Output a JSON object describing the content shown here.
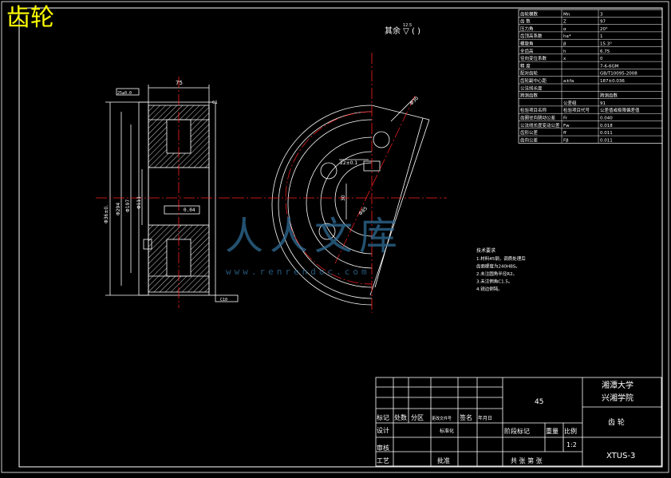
{
  "corner_title": "齿轮",
  "surface_note": "其余 ▽ ( )",
  "surface_note_small": "12.5",
  "watermark": {
    "text": "人人文库",
    "url": "www.renrendoc.com"
  },
  "dims": {
    "top_width": "75",
    "chamfer": "C1",
    "tol_box": "0.05",
    "dia_outer": "Φ36±0.",
    "dia_1": "Φ294",
    "dia_2": "Φ197",
    "dia_3": "Φ111",
    "runout": "0.04",
    "bore_small": "Φ30",
    "key_w": "22±0.1",
    "key_t": "30",
    "bore": "Φ85",
    "flatness_box": "0.0",
    "left_label": "25±0.0",
    "bottom_label": "C10"
  },
  "gear_table": [
    [
      "齿轮模数",
      "Mn",
      "3"
    ],
    [
      "齿    数",
      "Z",
      "97"
    ],
    [
      "压力角",
      "α",
      "20°"
    ],
    [
      "齿顶高系数",
      "ha*",
      "1"
    ],
    [
      "螺旋角",
      "β",
      "15.3°"
    ],
    [
      "全齿高",
      "h",
      "6.75"
    ],
    [
      "径向变位系数",
      "x",
      "0"
    ],
    [
      "精    度",
      "",
      "7-6-6GM"
    ],
    [
      "配对齿轮",
      "",
      "GB/T10095-2008"
    ],
    [
      "齿轮副中心距",
      "a±fa",
      "187±0.036"
    ],
    [
      "公法线长度",
      "",
      ""
    ],
    [
      "跨测齿数",
      "",
      "跨测齿数"
    ],
    [
      "",
      "公差组",
      "91"
    ],
    [
      "检验项目名称",
      "检验项目代号",
      "公差值或极限偏差值"
    ],
    [
      "齿圈径向跳动公差",
      "Fr",
      "0.040"
    ],
    [
      "公法线长度变动公差",
      "Fw",
      "0.018"
    ],
    [
      "齿形公差",
      "ff",
      "0.011"
    ],
    [
      "齿向公差",
      "Fβ",
      "0.011"
    ]
  ],
  "tech_req": {
    "title": "技术要求",
    "items": [
      "1.材料45钢，调质处理后",
      "齿面硬度为240HBS。",
      "2.未注圆角半径R2。",
      "3.未注倒角C1.5。",
      "4.锐边倒钝。"
    ]
  },
  "title_block": {
    "material": "45",
    "school_line1": "湘潭大学",
    "school_line2": "兴湘学院",
    "part_name": "齿    轮",
    "drawing_no": "XTUS-3",
    "scale": "1:2",
    "r1": [
      "标记",
      "处数",
      "分区",
      "更改文件号",
      "签名",
      "年月日"
    ],
    "design": "设计",
    "standard": "标准化",
    "stage_mark": "阶段标记",
    "weight": "重量",
    "ratio": "比例",
    "review": "审核",
    "process": "工艺",
    "approve": "批准",
    "sheets": "共  张  第  张"
  },
  "colors": {
    "line": "#ffffff",
    "center": "#ff2020",
    "hatch": "#ffffff",
    "title": "#ffff00",
    "watermark": "#2f6d96"
  }
}
